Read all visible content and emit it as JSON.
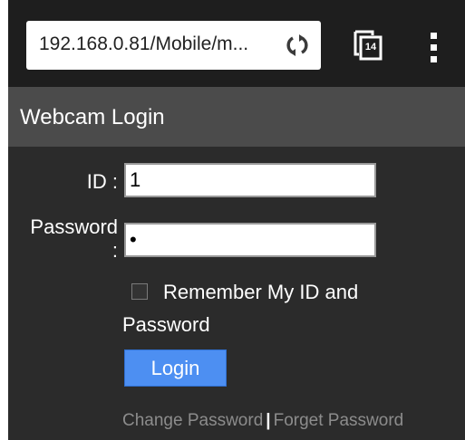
{
  "browser": {
    "url": "192.168.0.81/Mobile/m...",
    "tab_count": "14"
  },
  "page": {
    "title": "Webcam Login"
  },
  "form": {
    "id_label": "ID :",
    "id_value": "1",
    "password_label_line1": "Password",
    "password_label_line2": ":",
    "password_value": "•",
    "remember_label": "Remember My ID and Password",
    "remember_checked": false,
    "login_label": "Login"
  },
  "links": {
    "change_password": "Change Password",
    "separator": "|",
    "forget_password": "Forget Password"
  },
  "colors": {
    "background": "#2b2b2b",
    "titlebar": "#4b4b4b",
    "button": "#4d8ff2",
    "link": "#8c8c8c"
  }
}
